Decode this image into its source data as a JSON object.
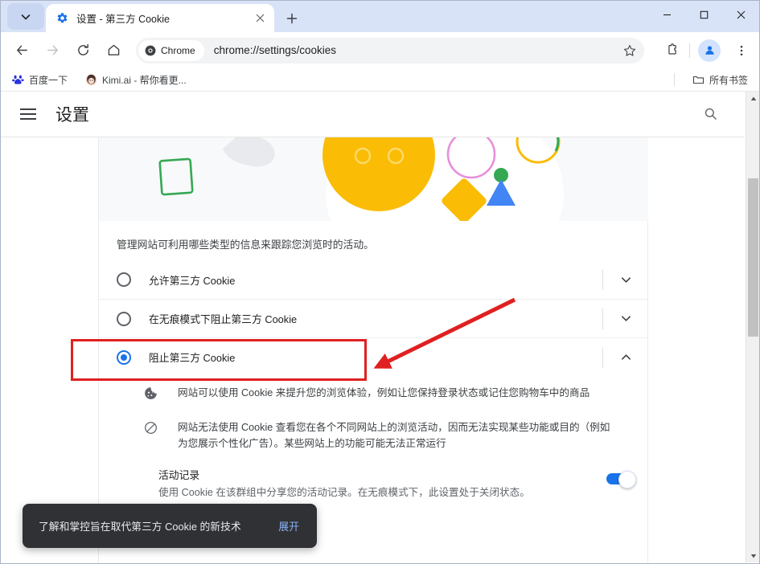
{
  "window": {
    "controls": {
      "minimize": "−",
      "maximize": "□",
      "close": "✕"
    }
  },
  "tabstrip": {
    "tab_search_label": "tab-search",
    "tabs": [
      {
        "title": "设置 - 第三方 Cookie",
        "favicon": "gear-icon",
        "close_label": "✕"
      }
    ],
    "new_tab_label": "+"
  },
  "toolbar": {
    "back_label": "←",
    "forward_label": "→",
    "reload_label": "⟳",
    "home_label": "⌂",
    "chrome_chip_label": "Chrome",
    "url": "chrome://settings/cookies",
    "star_label": "☆",
    "extensions_label": "extensions",
    "profile_label": "profile",
    "menu_label": "⋮"
  },
  "bookmarks": [
    {
      "label": "百度一下",
      "icon": "baidu-icon"
    },
    {
      "label": "Kimi.ai - 帮你看更...",
      "icon": "kimi-icon"
    }
  ],
  "bookmarks_right": {
    "label": "所有书签",
    "icon": "folder-icon"
  },
  "settings": {
    "title": "设置",
    "menu_label": "主菜单",
    "search_label": "搜索设置"
  },
  "content": {
    "intro": "管理网站可利用哪些类型的信息来跟踪您浏览时的活动。",
    "options": [
      {
        "label": "允许第三方 Cookie",
        "selected": false,
        "expander": "chevron-down-icon"
      },
      {
        "label": "在无痕模式下阻止第三方 Cookie",
        "selected": false,
        "expander": "chevron-down-icon"
      },
      {
        "label": "阻止第三方 Cookie",
        "selected": true,
        "expander": "chevron-up-icon"
      }
    ],
    "bullets": [
      {
        "icon": "cookie-icon",
        "text": "网站可以使用 Cookie 来提升您的浏览体验，例如让您保持登录状态或记住您购物车中的商品"
      },
      {
        "icon": "block-icon",
        "text": "网站无法使用 Cookie 查看您在各个不同网站上的浏览活动，因而无法实现某些功能或目的（例如为您展示个性化广告）。某些网站上的功能可能无法正常运行"
      }
    ],
    "group_setting": {
      "title": "活动记录",
      "description": "使用 Cookie 在该群组中分享您的活动记录。在无痕模式下，此设置处于关闭状态。",
      "toggle_on": true
    }
  },
  "toast": {
    "message": "了解和掌控旨在取代第三方 Cookie 的新技术",
    "action": "展开"
  },
  "colors": {
    "accent": "#1a73e8",
    "annotation": "#e02020",
    "toast_bg": "#303134",
    "link": "#8ab4f8",
    "banner_bg": "#f8f9fa"
  }
}
